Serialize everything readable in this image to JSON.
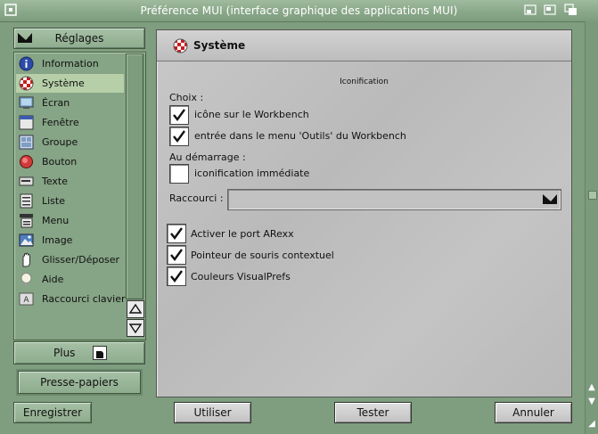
{
  "window": {
    "title": "Préférence MUI (interface graphique des applications MUI)"
  },
  "sidebar": {
    "header_label": "Réglages",
    "items": [
      {
        "label": "Information",
        "icon": "info-icon",
        "selected": false
      },
      {
        "label": "Système",
        "icon": "amiga-ball-icon",
        "selected": true
      },
      {
        "label": "Écran",
        "icon": "screen-icon",
        "selected": false
      },
      {
        "label": "Fenêtre",
        "icon": "window-icon",
        "selected": false
      },
      {
        "label": "Groupe",
        "icon": "group-icon",
        "selected": false
      },
      {
        "label": "Bouton",
        "icon": "button-icon",
        "selected": false
      },
      {
        "label": "Texte",
        "icon": "text-icon",
        "selected": false
      },
      {
        "label": "Liste",
        "icon": "list-icon",
        "selected": false
      },
      {
        "label": "Menu",
        "icon": "menu-icon",
        "selected": false
      },
      {
        "label": "Image",
        "icon": "image-icon",
        "selected": false
      },
      {
        "label": "Glisser/Déposer",
        "icon": "drag-drop-icon",
        "selected": false
      },
      {
        "label": "Aide",
        "icon": "help-bulb-icon",
        "selected": false
      },
      {
        "label": "Raccourci clavier",
        "icon": "keyboard-shortcut-icon",
        "selected": false
      }
    ],
    "plus_label": "Plus",
    "clipboard_label": "Presse-papiers"
  },
  "panel": {
    "title": "Système",
    "group_title": "Iconification",
    "choix_label": "Choix :",
    "checkbox_workbench_icon": {
      "label": "icône sur le Workbench",
      "checked": true
    },
    "checkbox_tools_menu": {
      "label": "entrée dans le menu 'Outils' du Workbench",
      "checked": true
    },
    "startup_label": "Au démarrage :",
    "checkbox_immediate": {
      "label": "iconification immédiate",
      "checked": false
    },
    "shortcut_label": "Raccourci :",
    "shortcut_value": "",
    "checkbox_arexx": {
      "label": "Activer le port ARexx",
      "checked": true
    },
    "checkbox_context_pointer": {
      "label": "Pointeur de souris contextuel",
      "checked": true
    },
    "checkbox_visualprefs": {
      "label": "Couleurs VisualPrefs",
      "checked": true
    }
  },
  "buttons": {
    "save": "Enregistrer",
    "use": "Utiliser",
    "test": "Tester",
    "cancel": "Annuler"
  },
  "colors": {
    "window_bg": "#7f9d7f",
    "selection": "#b6cfa8",
    "panel_bg": "#c2c2c2"
  }
}
